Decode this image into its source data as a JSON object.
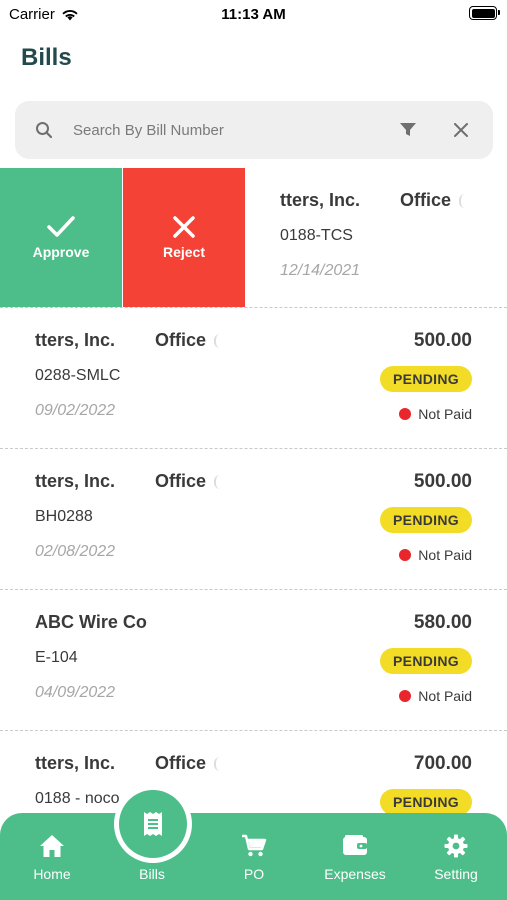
{
  "status_bar": {
    "carrier": "Carrier",
    "time": "11:13 AM"
  },
  "header": {
    "title": "Bills"
  },
  "search": {
    "placeholder": "Search By Bill Number",
    "value": ""
  },
  "swipe_actions": {
    "approve_label": "Approve",
    "reject_label": "Reject"
  },
  "bills": [
    {
      "vendor": "tters, Inc.",
      "department": "Office",
      "bill_number": "0188-TCS",
      "date": "12/14/2021",
      "amount": "",
      "status": "",
      "payment_status": ""
    },
    {
      "vendor": "tters, Inc.",
      "department": "Office",
      "bill_number": "0288-SMLC",
      "date": "09/02/2022",
      "amount": "500.00",
      "status": "PENDING",
      "payment_status": "Not Paid"
    },
    {
      "vendor": "tters, Inc.",
      "department": "Office",
      "bill_number": "BH0288",
      "date": "02/08/2022",
      "amount": "500.00",
      "status": "PENDING",
      "payment_status": "Not Paid"
    },
    {
      "vendor": "ABC Wire Co",
      "department": "",
      "bill_number": "E-104",
      "date": "04/09/2022",
      "amount": "580.00",
      "status": "PENDING",
      "payment_status": "Not Paid"
    },
    {
      "vendor": "tters, Inc.",
      "department": "Office",
      "bill_number": "0188 - noco",
      "date": "",
      "amount": "700.00",
      "status": "PENDING",
      "payment_status": ""
    }
  ],
  "tab_bar": {
    "items": [
      {
        "label": "Home",
        "icon": "home-icon"
      },
      {
        "label": "Bills",
        "icon": "receipt-icon",
        "active": true
      },
      {
        "label": "PO",
        "icon": "cart-icon"
      },
      {
        "label": "Expenses",
        "icon": "wallet-icon"
      },
      {
        "label": "Setting",
        "icon": "gear-icon"
      }
    ]
  },
  "colors": {
    "accent": "#4dbd8a",
    "reject": "#f44336",
    "pending_badge": "#f2dc26",
    "not_paid_dot": "#e8262b",
    "title": "#22494b"
  }
}
